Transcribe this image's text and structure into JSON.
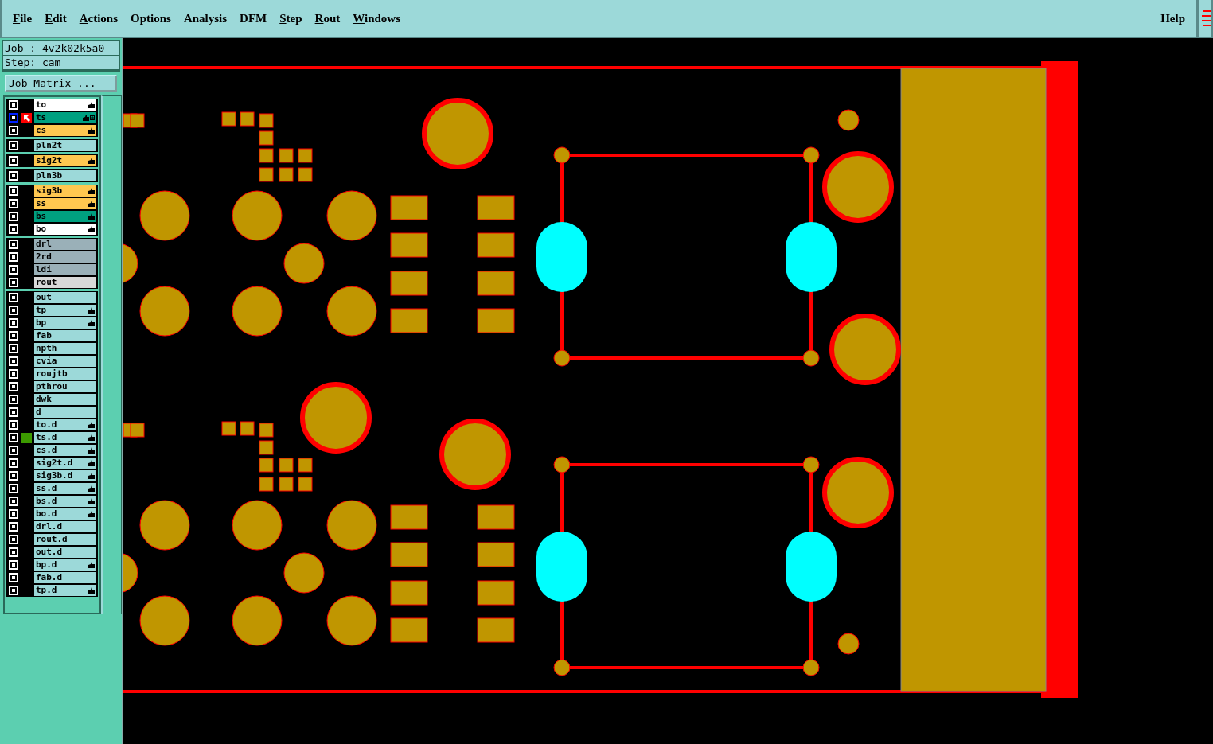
{
  "menu": [
    {
      "label": "File",
      "underline": true
    },
    {
      "label": "Edit",
      "underline": true
    },
    {
      "label": "Actions",
      "underline": true
    },
    {
      "label": "Options",
      "underline": false
    },
    {
      "label": "Analysis",
      "underline": false
    },
    {
      "label": "DFM",
      "underline": false
    },
    {
      "label": "Step",
      "underline": true
    },
    {
      "label": "Rout",
      "underline": true
    },
    {
      "label": "Windows",
      "underline": true
    }
  ],
  "help": {
    "label": "Help"
  },
  "job": {
    "label": "Job : 4v2k02k5a0",
    "step": "Step: cam"
  },
  "matrix_button": "Job Matrix ...",
  "layer_groups": [
    [
      {
        "name": "to",
        "color": "#ffffff",
        "hand": true,
        "work": false,
        "shown": false,
        "checked": false
      },
      {
        "name": "ts",
        "color": "#00a080",
        "hand": true,
        "work": true,
        "shown": false,
        "checked": false
      },
      {
        "name": "cs",
        "color": "#ffc850",
        "hand": true,
        "work": false,
        "shown": false,
        "checked": false
      }
    ],
    [
      {
        "name": "pln2t",
        "color": "#9cd9d9",
        "hand": false,
        "work": false,
        "shown": false,
        "checked": false
      }
    ],
    [
      {
        "name": "sig2t",
        "color": "#ffc850",
        "hand": true,
        "work": false,
        "shown": false,
        "checked": false
      }
    ],
    [
      {
        "name": "pln3b",
        "color": "#9cd9d9",
        "hand": false,
        "work": false,
        "shown": false,
        "checked": false
      }
    ],
    [
      {
        "name": "sig3b",
        "color": "#ffc850",
        "hand": true,
        "work": false,
        "shown": false,
        "checked": false
      },
      {
        "name": "ss",
        "color": "#ffc850",
        "hand": true,
        "work": false,
        "shown": false,
        "checked": false
      },
      {
        "name": "bs",
        "color": "#00a080",
        "hand": true,
        "work": false,
        "shown": false,
        "checked": false
      },
      {
        "name": "bo",
        "color": "#ffffff",
        "hand": true,
        "work": false,
        "shown": false,
        "checked": false
      }
    ],
    [
      {
        "name": "drl",
        "color": "#9ab0b8",
        "hand": false,
        "work": false,
        "shown": false,
        "checked": false
      },
      {
        "name": "2rd",
        "color": "#9ab0b8",
        "hand": false,
        "work": false,
        "shown": false,
        "checked": false
      },
      {
        "name": "ldi",
        "color": "#9ab0b8",
        "hand": false,
        "work": false,
        "shown": false,
        "checked": false
      },
      {
        "name": "rout",
        "color": "#d8d8d8",
        "hand": false,
        "work": false,
        "shown": false,
        "checked": false
      }
    ],
    [
      {
        "name": "out",
        "color": "#9cd9d9",
        "hand": false,
        "work": false,
        "shown": false,
        "checked": false
      },
      {
        "name": "tp",
        "color": "#9cd9d9",
        "hand": true,
        "work": false,
        "shown": false,
        "checked": false
      },
      {
        "name": "bp",
        "color": "#9cd9d9",
        "hand": true,
        "work": false,
        "shown": false,
        "checked": false
      },
      {
        "name": "fab",
        "color": "#9cd9d9",
        "hand": false,
        "work": false,
        "shown": false,
        "checked": false
      },
      {
        "name": "npth",
        "color": "#9cd9d9",
        "hand": false,
        "work": false,
        "shown": false,
        "checked": false
      },
      {
        "name": "cvia",
        "color": "#9cd9d9",
        "hand": false,
        "work": false,
        "shown": false,
        "checked": false
      },
      {
        "name": "roujtb",
        "color": "#9cd9d9",
        "hand": false,
        "work": false,
        "shown": false,
        "checked": false
      },
      {
        "name": "pthrou",
        "color": "#9cd9d9",
        "hand": false,
        "work": false,
        "shown": false,
        "checked": false
      },
      {
        "name": "dwk",
        "color": "#9cd9d9",
        "hand": false,
        "work": false,
        "shown": false,
        "checked": false
      },
      {
        "name": "d",
        "color": "#9cd9d9",
        "hand": false,
        "work": false,
        "shown": false,
        "checked": false
      },
      {
        "name": "to.d",
        "color": "#9cd9d9",
        "hand": true,
        "work": false,
        "shown": false,
        "checked": false
      },
      {
        "name": "ts.d",
        "color": "#9cd9d9",
        "hand": true,
        "work": false,
        "shown": true,
        "checked": false
      },
      {
        "name": "cs.d",
        "color": "#9cd9d9",
        "hand": true,
        "work": false,
        "shown": false,
        "checked": false
      },
      {
        "name": "sig2t.d",
        "color": "#9cd9d9",
        "hand": true,
        "work": false,
        "shown": false,
        "checked": false
      },
      {
        "name": "sig3b.d",
        "color": "#9cd9d9",
        "hand": true,
        "work": false,
        "shown": false,
        "checked": false
      },
      {
        "name": "ss.d",
        "color": "#9cd9d9",
        "hand": true,
        "work": false,
        "shown": false,
        "checked": false
      },
      {
        "name": "bs.d",
        "color": "#9cd9d9",
        "hand": true,
        "work": false,
        "shown": false,
        "checked": false
      },
      {
        "name": "bo.d",
        "color": "#9cd9d9",
        "hand": true,
        "work": false,
        "shown": false,
        "checked": false
      },
      {
        "name": "drl.d",
        "color": "#9cd9d9",
        "hand": false,
        "work": false,
        "shown": false,
        "checked": false
      },
      {
        "name": "rout.d",
        "color": "#9cd9d9",
        "hand": false,
        "work": false,
        "shown": false,
        "checked": false
      },
      {
        "name": "out.d",
        "color": "#9cd9d9",
        "hand": false,
        "work": false,
        "shown": false,
        "checked": false
      },
      {
        "name": "bp.d",
        "color": "#9cd9d9",
        "hand": true,
        "work": false,
        "shown": false,
        "checked": false
      },
      {
        "name": "fab.d",
        "color": "#9cd9d9",
        "hand": false,
        "work": false,
        "shown": false,
        "checked": false
      },
      {
        "name": "tp.d",
        "color": "#9cd9d9",
        "hand": true,
        "work": false,
        "shown": false,
        "checked": false
      }
    ]
  ]
}
